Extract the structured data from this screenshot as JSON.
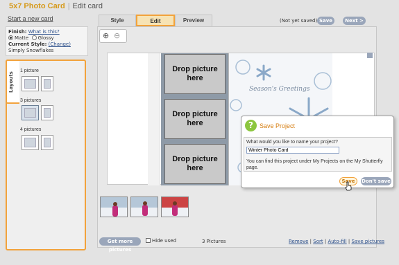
{
  "header": {
    "brand": "5x7 Photo Card",
    "separator": "|",
    "subtitle": "Edit card"
  },
  "start_link": "Start a new card",
  "info": {
    "finish_label": "Finish:",
    "finish_link": "What is this?",
    "matte": "Matte",
    "glossy": "Glossy",
    "style_label": "Current Style:",
    "style_link": "(Change)",
    "style_name": "Simply Snowflakes"
  },
  "layouts": {
    "tab_label": "Layouts",
    "groups": [
      {
        "label": "1 picture"
      },
      {
        "label": "3 pictures"
      },
      {
        "label": "4 pictures"
      }
    ]
  },
  "tabs": {
    "style": "Style",
    "edit": "Edit",
    "preview": "Preview"
  },
  "toolbar": {
    "status": "(Not yet saved)",
    "save": "Save",
    "next": "Next >"
  },
  "zoom": {
    "in": "⊕",
    "out": "⊖"
  },
  "card": {
    "slots": [
      "Drop picture here",
      "Drop picture here",
      "Drop picture here"
    ],
    "greeting": "Season's Greetings"
  },
  "bottom": {
    "get_more": "Get more pictures",
    "hide_used": "Hide used",
    "count": "3 Pictures",
    "remove": "Remove",
    "sort": "Sort",
    "autofill": "Auto-fill",
    "save_pictures": "Save pictures",
    "pipe": "|"
  },
  "dialog": {
    "icon": "?",
    "title": "Save Project",
    "question": "What would you like to name your project?",
    "value": "Winter Photo Card",
    "note": "You can find this project under My Projects on the My Shutterfly page.",
    "save": "Save",
    "dont_save": "Don't save"
  },
  "colors": {
    "accent": "#f2a23b",
    "brand": "#d69a1c",
    "button": "#9aa6ba",
    "link": "#2a4e8a"
  }
}
